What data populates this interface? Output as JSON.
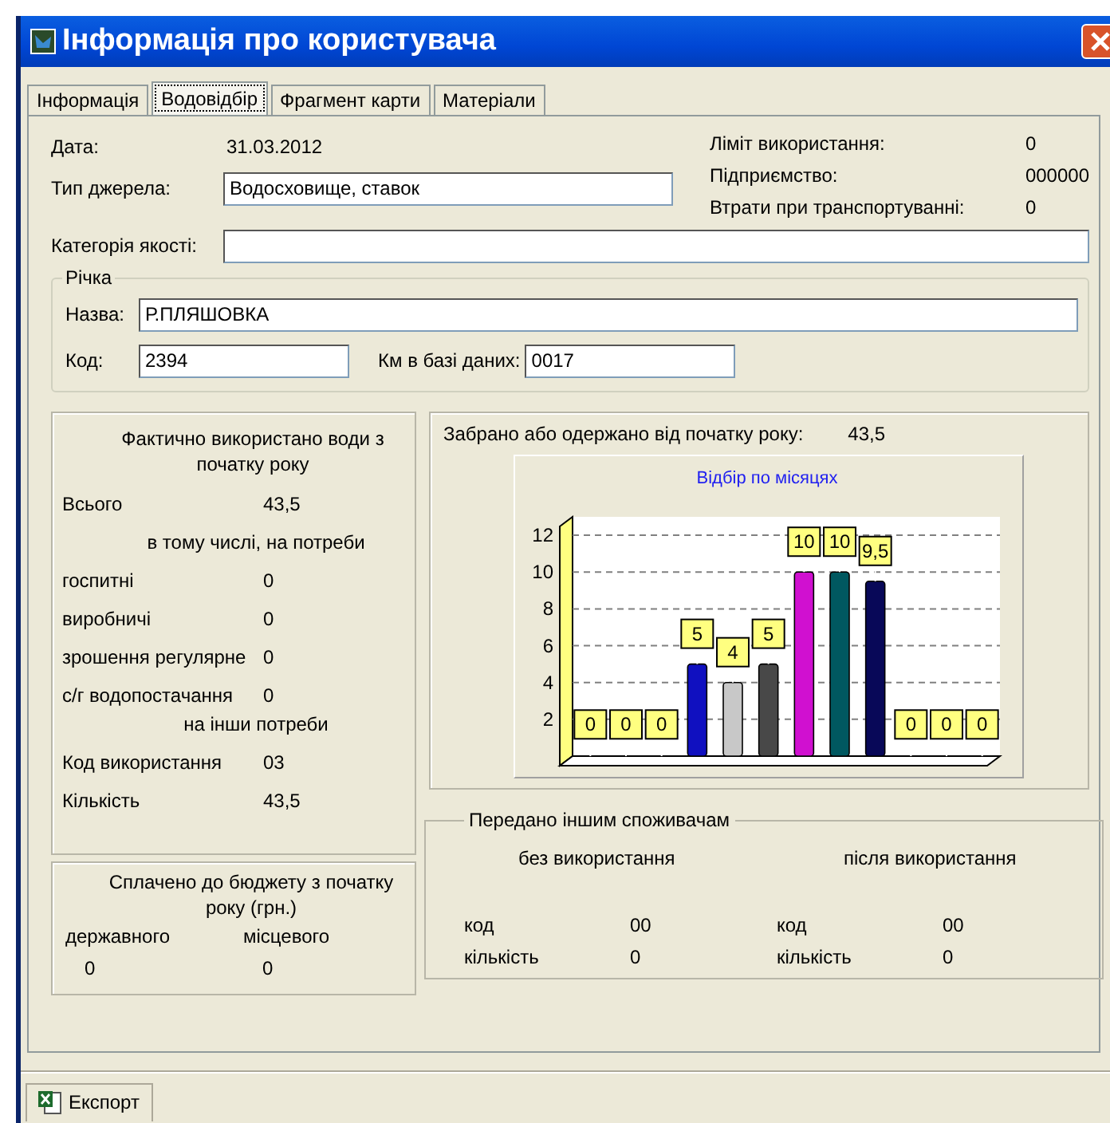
{
  "window": {
    "title": "Інформація про користувача"
  },
  "tabs": [
    {
      "label": "Інформація",
      "selected": false
    },
    {
      "label": "Водовідбір",
      "selected": true
    },
    {
      "label": "Фрагмент карти",
      "selected": false
    },
    {
      "label": "Матеріали",
      "selected": false
    }
  ],
  "header": {
    "date": {
      "label": "Дата:",
      "value": "31.03.2012"
    },
    "source_type": {
      "label": "Тип джерела:",
      "value": "Водосховище, ставок"
    },
    "quality": {
      "label": "Категорія якості:"
    },
    "info": [
      {
        "label": "Ліміт використання:",
        "value": "0"
      },
      {
        "label": "Підприємство:",
        "value": "000000"
      },
      {
        "label": "Втрати при транспортуванні:",
        "value": "0"
      }
    ]
  },
  "river": {
    "title": "Річка",
    "name": {
      "label": "Назва:",
      "value": "Р.ПЛЯШОВКА"
    },
    "code": {
      "label": "Код:",
      "value": "2394"
    },
    "km": {
      "label": "Км в базі даних:",
      "value": "0017"
    }
  },
  "usage": {
    "title": "Фактично використано води з початку року",
    "total": {
      "label": "Всього",
      "value": "43,5"
    },
    "subtitle": "в тому числі, на потреби",
    "items": [
      {
        "label": "госпитні",
        "value": "0"
      },
      {
        "label": "виробничі",
        "value": "0"
      },
      {
        "label": "зрошення регулярне",
        "value": "0"
      },
      {
        "label": "с/г водопостачання",
        "value": "0"
      }
    ],
    "other_subtitle": "на інши потреби",
    "other": [
      {
        "label": "Код використання",
        "value": "03"
      },
      {
        "label": "Кількість",
        "value": "43,5"
      }
    ]
  },
  "budget": {
    "title": "Сплачено до бюджету з початку року (грн.)",
    "columns": [
      {
        "label": "державного",
        "value": "0"
      },
      {
        "label": "місцевого",
        "value": "0"
      }
    ]
  },
  "withdrawn": {
    "label": "Забрано або одержано від початку року:",
    "value": "43,5",
    "chart_data": {
      "type": "bar",
      "title": "Відбір по місяцях",
      "values": [
        0,
        0,
        0,
        5,
        4,
        5,
        10,
        10,
        9.5,
        0,
        0,
        0
      ],
      "ylim": [
        0,
        13
      ],
      "grid": true,
      "yticks": [
        2,
        4,
        6,
        8,
        10,
        12
      ],
      "value_labels": [
        "0",
        "0",
        "0",
        "5",
        "4",
        "5",
        "10",
        "10",
        "9,5",
        "0",
        "0",
        "0"
      ]
    }
  },
  "transfer": {
    "title": "Передано іншим споживачам",
    "columns": [
      {
        "heading": "без використання",
        "rows": [
          {
            "label": "код",
            "value": "00"
          },
          {
            "label": "кількість",
            "value": "0"
          }
        ]
      },
      {
        "heading": "після використання",
        "rows": [
          {
            "label": "код",
            "value": "00"
          },
          {
            "label": "кількість",
            "value": "0"
          }
        ]
      }
    ]
  },
  "toolbar": {
    "export": "Експорт"
  }
}
